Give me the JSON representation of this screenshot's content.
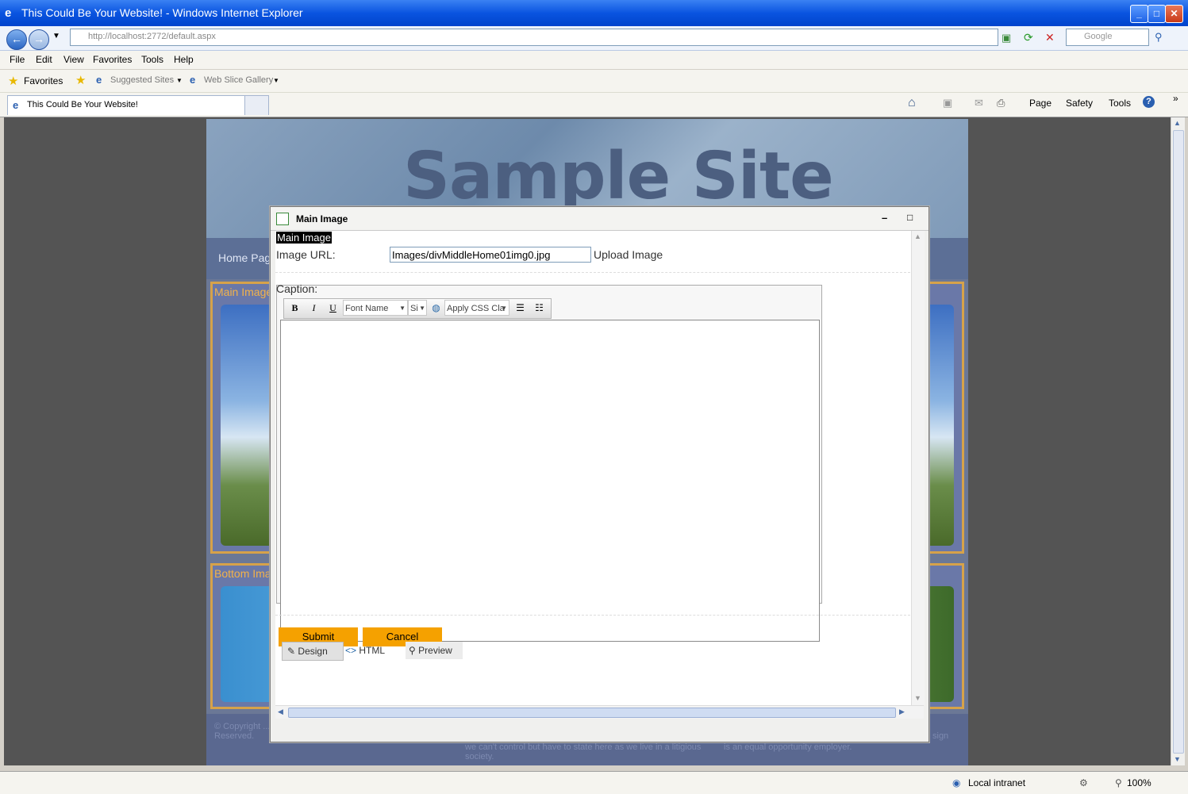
{
  "window": {
    "title": "This Could Be Your Website! - Windows Internet Explorer"
  },
  "nav": {
    "url": "http://localhost:2772/default.aspx",
    "search_placeholder": "Google"
  },
  "menu": [
    "File",
    "Edit",
    "View",
    "Favorites",
    "Tools",
    "Help"
  ],
  "favorites": {
    "label": "Favorites",
    "items": [
      "Suggested Sites",
      "Web Slice Gallery"
    ]
  },
  "tab": {
    "title": "This Could Be Your Website!"
  },
  "commandbar": [
    "Page",
    "Safety",
    "Tools"
  ],
  "site": {
    "banner": "Sample Site",
    "nav_home": "Home Pag",
    "panel1_title": "Main Image",
    "panel2_title": "Bottom Ima",
    "footer_left": "© Copyright ... Reserved.",
    "footer_mid": "we can't control but have to state here as we live in a litigious society.",
    "footer_right": "is an equal opportunity employer.",
    "footer_sign": "sign"
  },
  "dialog": {
    "title": "Main Image",
    "heading": "Main Image",
    "image_url_label": "Image URL:",
    "image_url_value": "Images/divMiddleHome01img0.jpg",
    "upload_label": "Upload Image",
    "caption_label": "Caption:",
    "toolbar": {
      "font_name": "Font Name",
      "size": "Si",
      "css_class": "Apply CSS Cla"
    },
    "submit": "Submit",
    "cancel": "Cancel",
    "view_tabs": [
      "Design",
      "HTML",
      "Preview"
    ]
  },
  "status": {
    "zone": "Local intranet",
    "zoom": "100%"
  }
}
